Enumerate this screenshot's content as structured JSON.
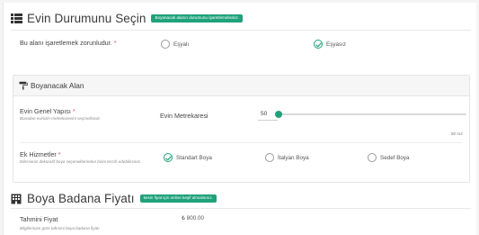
{
  "section_home": {
    "title": "Evin Durumunu Seçin",
    "badge": "Boyanacak alanın durumunu işaretlemelisiniz.",
    "question": "Bu alanı işaretlemek zorunludur.",
    "required_mark": "*",
    "options": [
      {
        "label": "Eşyalı",
        "checked": false
      },
      {
        "label": "Eşyasız",
        "checked": true
      }
    ]
  },
  "card": {
    "title": "Boyanacak Alan",
    "field_structure": {
      "label": "Evin Genel Yapısı",
      "required_mark": "*",
      "hint": "Buradan evinizin metrekaresini seçmelisiniz."
    },
    "square_meter": {
      "label": "Evin Metrekaresi",
      "value": "50",
      "max_label": "50 m2"
    },
    "extra_services": {
      "label": "Ek Hizmetler",
      "required_mark": "*",
      "hint": "Dilerseniz dekoratif boya seçeneklerinden birini tercih edebilirsiniz.",
      "options": [
        {
          "label": "Standart Boya",
          "checked": true
        },
        {
          "label": "İtalyan Boya",
          "checked": false
        },
        {
          "label": "Sedef Boya",
          "checked": false
        }
      ]
    }
  },
  "section_price": {
    "title": "Boya Badana Fiyatı",
    "badge": "kesin fiyat için online keşif almalısınız.",
    "estimate_label": "Tahmini Fiyat",
    "estimate_hint": "Bilgilerinize göre tahmini boya badana fiyatı",
    "estimate_value": "₺ 800.00"
  },
  "colors": {
    "accent": "#1fa27a",
    "required": "#e05050"
  }
}
